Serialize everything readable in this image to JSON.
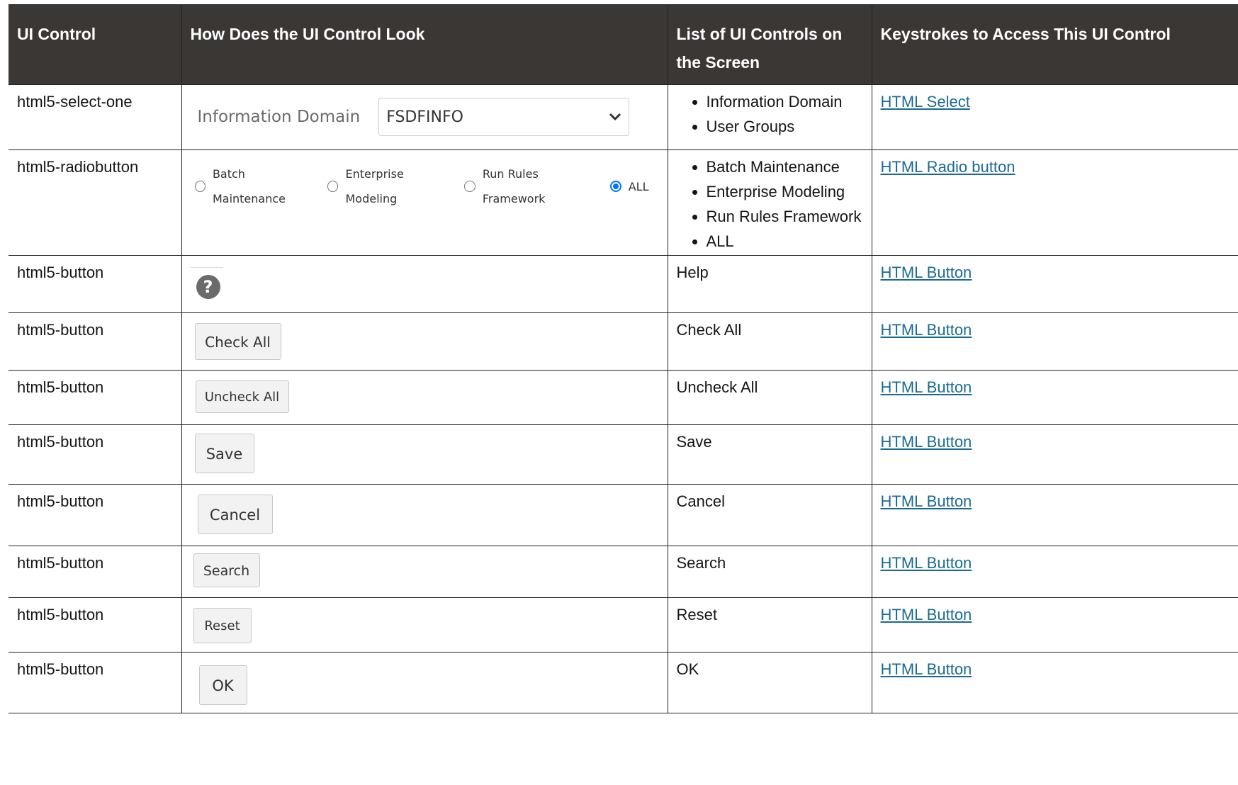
{
  "table": {
    "headers": [
      "UI Control",
      "How Does the UI Control Look",
      "List of UI Controls on the Screen",
      "Keystrokes to Access This UI Control"
    ],
    "rows": [
      {
        "control": "html5-select-one",
        "controls_list": [
          "Information Domain",
          "User Groups"
        ],
        "link": "HTML Select"
      },
      {
        "control": "html5-radiobutton",
        "controls_list": [
          "Batch Maintenance",
          "Enterprise Modeling",
          "Run Rules Framework",
          "ALL"
        ],
        "link": "HTML Radio button"
      },
      {
        "control": "html5-button",
        "controls_list": [
          "Help"
        ],
        "link": "HTML Button"
      },
      {
        "control": "html5-button",
        "controls_list": [
          "Check All"
        ],
        "link": "HTML Button"
      },
      {
        "control": "html5-button",
        "controls_list": [
          "Uncheck All"
        ],
        "link": "HTML Button"
      },
      {
        "control": "html5-button",
        "controls_list": [
          "Save"
        ],
        "link": "HTML Button"
      },
      {
        "control": "html5-button",
        "controls_list": [
          "Cancel"
        ],
        "link": "HTML Button"
      },
      {
        "control": "html5-button",
        "controls_list": [
          "Search"
        ],
        "link": "HTML Button"
      },
      {
        "control": "html5-button",
        "controls_list": [
          "Reset"
        ],
        "link": "HTML Button"
      },
      {
        "control": "html5-button",
        "controls_list": [
          "OK"
        ],
        "link": "HTML Button"
      }
    ]
  },
  "previews": {
    "select": {
      "label": "Information Domain",
      "value": "FSDFINFO"
    },
    "radios": [
      {
        "label": "Batch Maintenance",
        "selected": false
      },
      {
        "label": "Enterprise Modeling",
        "selected": false
      },
      {
        "label": "Run Rules Framework",
        "selected": false
      },
      {
        "label": "ALL",
        "selected": true
      }
    ],
    "help_glyph": "?",
    "buttons": [
      "Check All",
      "Uncheck All",
      "Save",
      "Cancel",
      "Search",
      "Reset",
      "OK"
    ]
  },
  "colors": {
    "header_bg": "#3b3735",
    "link": "#1b6a93",
    "radio_selected": "#0075ff"
  },
  "icons": {
    "select_chevron": "chevron-down-icon",
    "help": "help-icon"
  }
}
